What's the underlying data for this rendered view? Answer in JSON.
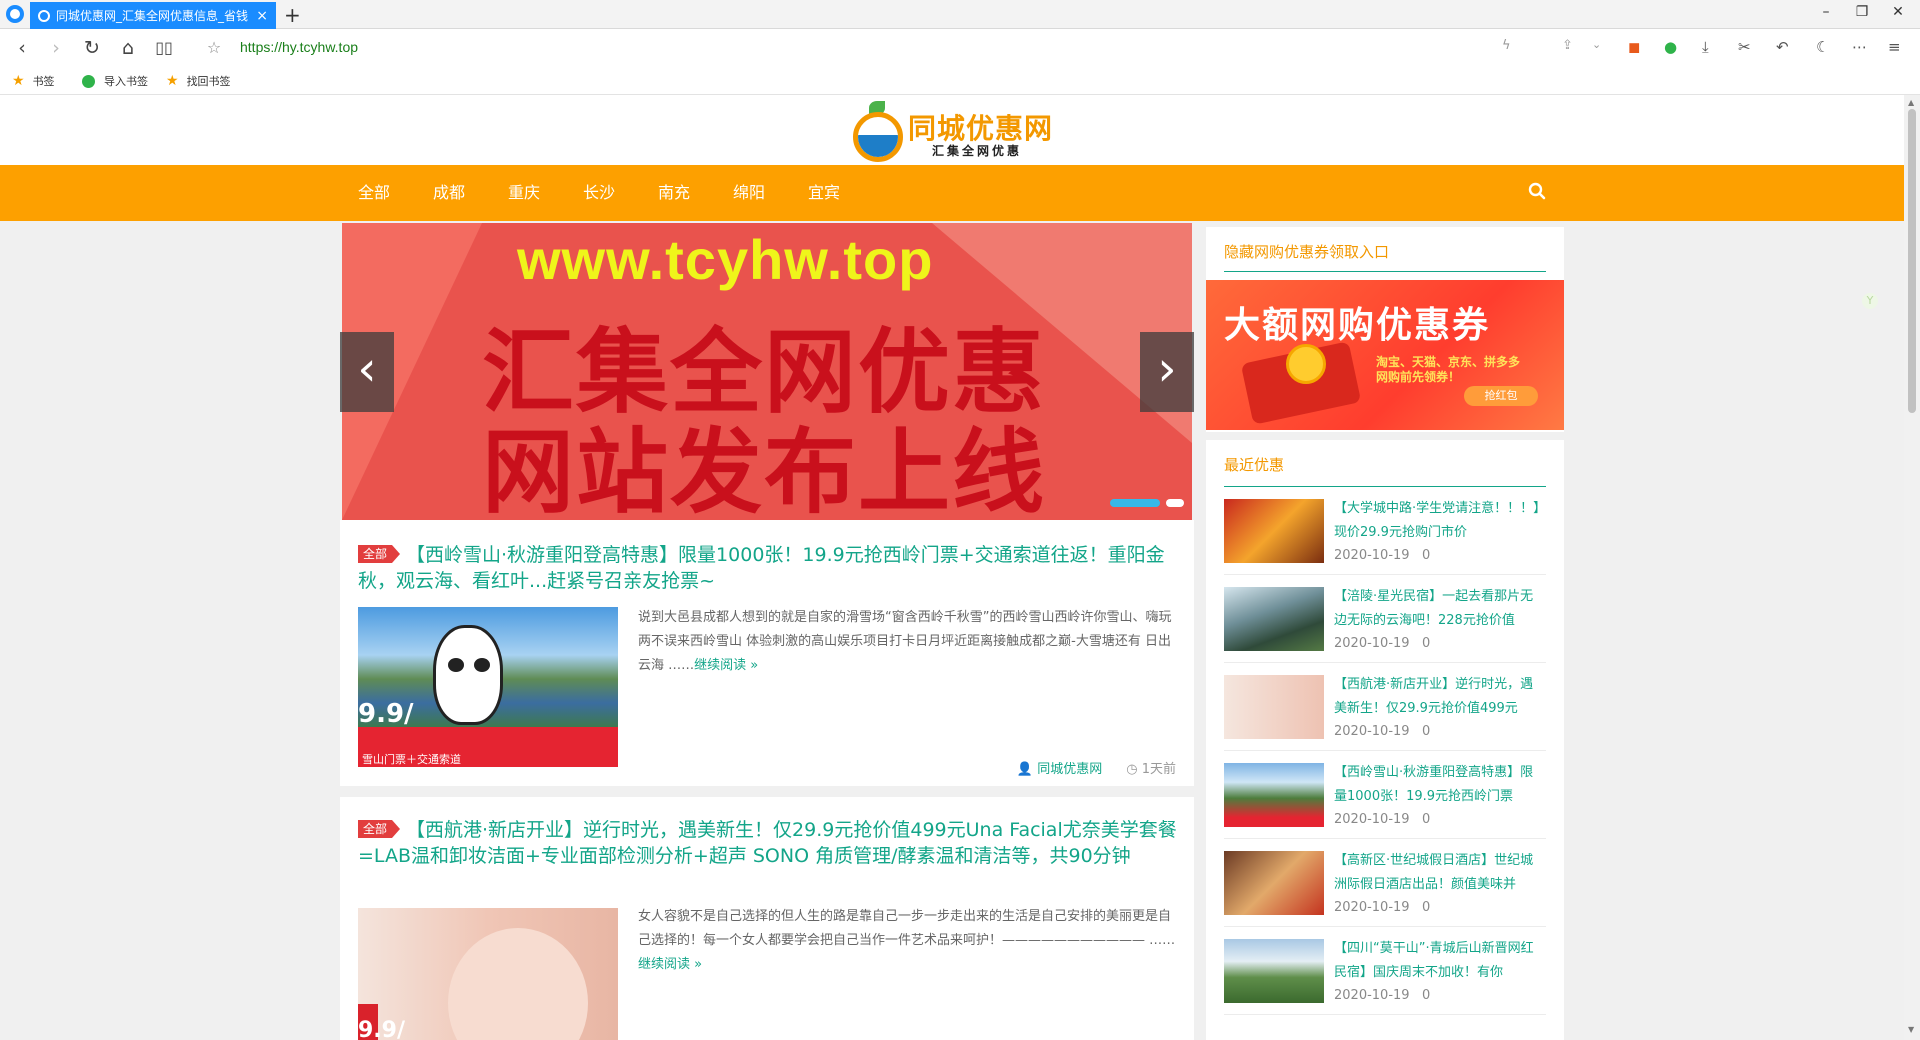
{
  "browser": {
    "tab_title": "同城优惠网_汇集全网优惠信息_省钱",
    "tab_close": "×",
    "new_tab": "+",
    "url": "https://hy.tcyhw.top",
    "bookmarks": [
      "书签",
      "导入书签",
      "找回书签"
    ],
    "win_min": "–",
    "win_max": "❐",
    "win_close": "✕"
  },
  "site": {
    "logo_title": "同城优惠网",
    "logo_sub": "汇集全网优惠",
    "nav": [
      "全部",
      "成都",
      "重庆",
      "长沙",
      "南充",
      "绵阳",
      "宜宾"
    ]
  },
  "slider": {
    "url_text": "www.tcyhw.top",
    "line1": "汇集全网优惠",
    "line2": "网站发布上线",
    "prev": "‹",
    "next": "›"
  },
  "articles": [
    {
      "badge": "全部",
      "title": "【西岭雪山·秋游重阳登高特惠】限量1000张！19.9元抢西岭门票+交通索道往返！重阳金秋，观云海、看红叶...赶紧号召亲友抢票~",
      "excerpt": "说到大邑县成都人想到的就是自家的滑雪场“窗含西岭千秋雪”的西岭雪山西岭许你雪山、嗨玩两不误来西岭雪山 体验刺激的高山娱乐项目打卡日月坪近距离接触成都之巅-大雪塘还有 日出云海 ……",
      "readmore": "继续阅读 »",
      "author": "同城优惠网",
      "time": "1天前",
      "thumb_big": "9.9/",
      "thumb_caption": "雪山门票＋交通索道"
    },
    {
      "badge": "全部",
      "title": "【西航港·新店开业】逆行时光，遇美新生！仅29.9元抢价值499元Una Facial尤奈美学套餐=LAB温和卸妆洁面+专业面部检测分析+超声 SONO 角质管理/酵素温和清洁等，共90分钟",
      "excerpt": "女人容貌不是自己选择的但人生的路是靠自己一步一步走出来的生活是自己安排的美丽更是自己选择的！每一个女人都要学会把自己当作一件艺术品来呵护！——————————— ……",
      "readmore": "继续阅读 »",
      "thumb_big": "9.9/"
    }
  ],
  "sidebar": {
    "widget1_title": "隐藏网购优惠券领取入口",
    "banner_title": "大额网购优惠券",
    "banner_sub": "淘宝、天猫、京东、拼多多 网购前先领券！",
    "banner_btn": "抢红包",
    "widget2_title": "最近优惠",
    "posts": [
      {
        "title": "【大学城中路·学生党请注意！！！】现价29.9元抢购门市价",
        "date": "2020-10-19",
        "count": "0"
      },
      {
        "title": "【涪陵·星光民宿】一起去看那片无边无际的云海吧！228元抢价值",
        "date": "2020-10-19",
        "count": "0"
      },
      {
        "title": "【西航港·新店开业】逆行时光，遇美新生！仅29.9元抢价值499元",
        "date": "2020-10-19",
        "count": "0"
      },
      {
        "title": "【西岭雪山·秋游重阳登高特惠】限量1000张！19.9元抢西岭门票",
        "date": "2020-10-19",
        "count": "0"
      },
      {
        "title": "【高新区·世纪城假日酒店】世纪城洲际假日酒店出品！颜值美味并",
        "date": "2020-10-19",
        "count": "0"
      },
      {
        "title": "【四川“莫干山”·青城后山新晋网红民宿】国庆周末不加收！有你",
        "date": "2020-10-19",
        "count": "0"
      }
    ]
  },
  "colors": {
    "accent_orange": "#fda000",
    "link_green": "#13a589",
    "browser_tab_blue": "#1a8cff",
    "badge_red": "#e23e3e"
  }
}
